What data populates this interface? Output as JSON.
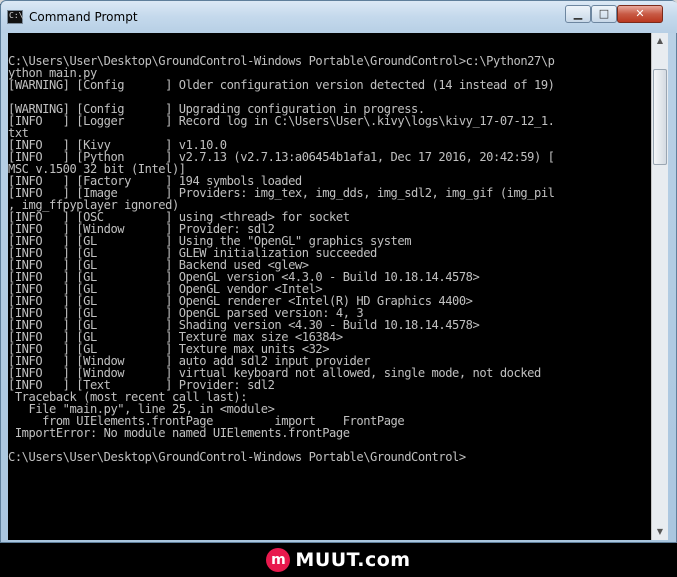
{
  "window": {
    "title": "Command Prompt",
    "icon": "cmd-icon",
    "controls": {
      "minimize": "▁",
      "maximize": "□",
      "close": "✕"
    }
  },
  "console": {
    "lines": [
      "C:\\Users\\User\\Desktop\\GroundControl-Windows Portable\\GroundControl>c:\\Python27\\p",
      "ython main.py",
      "[WARNING] [Config      ] Older configuration version detected (14 instead of 19)",
      "",
      "[WARNING] [Config      ] Upgrading configuration in progress.",
      "[INFO   ] [Logger      ] Record log in C:\\Users\\User\\.kivy\\logs\\kivy_17-07-12_1.",
      "txt",
      "[INFO   ] [Kivy        ] v1.10.0",
      "[INFO   ] [Python      ] v2.7.13 (v2.7.13:a06454b1afa1, Dec 17 2016, 20:42:59) [",
      "MSC v.1500 32 bit (Intel)]",
      "[INFO   ] [Factory     ] 194 symbols loaded",
      "[INFO   ] [Image       ] Providers: img_tex, img_dds, img_sdl2, img_gif (img_pil",
      ", img_ffpyplayer ignored)",
      "[INFO   ] [OSC         ] using <thread> for socket",
      "[INFO   ] [Window      ] Provider: sdl2",
      "[INFO   ] [GL          ] Using the \"OpenGL\" graphics system",
      "[INFO   ] [GL          ] GLEW initialization succeeded",
      "[INFO   ] [GL          ] Backend used <glew>",
      "[INFO   ] [GL          ] OpenGL version <4.3.0 - Build 10.18.14.4578>",
      "[INFO   ] [GL          ] OpenGL vendor <Intel>",
      "[INFO   ] [GL          ] OpenGL renderer <Intel(R) HD Graphics 4400>",
      "[INFO   ] [GL          ] OpenGL parsed version: 4, 3",
      "[INFO   ] [GL          ] Shading version <4.30 - Build 10.18.14.4578>",
      "[INFO   ] [GL          ] Texture max size <16384>",
      "[INFO   ] [GL          ] Texture max units <32>",
      "[INFO   ] [Window      ] auto add sdl2 input provider",
      "[INFO   ] [Window      ] virtual keyboard not allowed, single mode, not docked",
      "[INFO   ] [Text        ] Provider: sdl2",
      " Traceback (most recent call last):",
      "   File \"main.py\", line 25, in <module>",
      "     from UIElements.frontPage         import    FrontPage",
      " ImportError: No module named UIElements.frontPage",
      "",
      "C:\\Users\\User\\Desktop\\GroundControl-Windows Portable\\GroundControl>"
    ]
  },
  "scrollbar": {
    "up": "▲",
    "down": "▼"
  },
  "watermark": {
    "logo_letter": "m",
    "text": "MUUT.com"
  }
}
